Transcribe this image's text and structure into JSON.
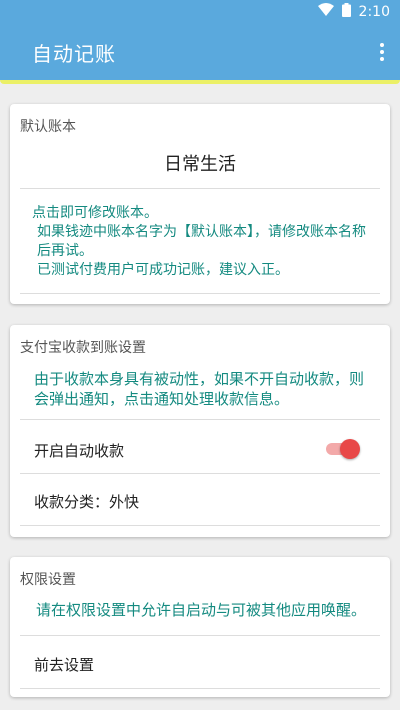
{
  "status_bar": {
    "time": "2:10",
    "icons": [
      "wifi-icon",
      "battery-icon"
    ]
  },
  "app_bar": {
    "title": "自动记账",
    "overflow_icon": "more-vert-icon"
  },
  "colors": {
    "primary": "#5aa9dd",
    "accent": "#ebf067",
    "info_text": "#148a80",
    "toggle_on": "#e84848"
  },
  "default_ledger": {
    "section_title": "默认账本",
    "ledger_name": "日常生活",
    "notes": [
      "点击即可修改账本。",
      "如果钱迹中账本名字为【默认账本】，请修改账本名称后再试。",
      "已测试付费用户可成功记账，建议入正。"
    ]
  },
  "alipay": {
    "section_title": "支付宝收款到账设置",
    "note": "由于收款本身具有被动性，如果不开自动收款，则会弹出通知，点击通知处理收款信息。",
    "auto_collect_label": "开启自动收款",
    "auto_collect_on": true,
    "category_label": "收款分类：外快"
  },
  "permissions": {
    "section_title": "权限设置",
    "note": "请在权限设置中允许自启动与可被其他应用唤醒。",
    "goto_label": "前去设置"
  }
}
